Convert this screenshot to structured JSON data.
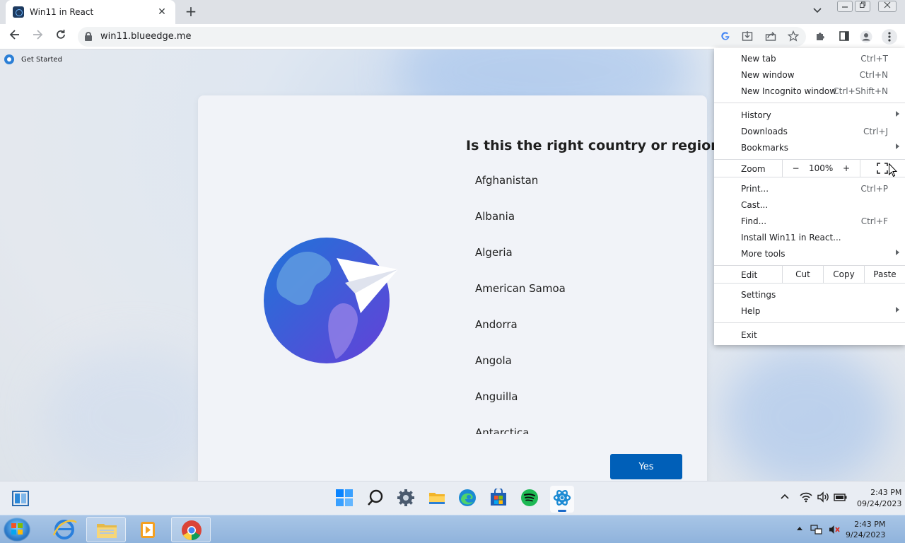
{
  "browser": {
    "tab_title": "Win11 in React",
    "tab_close": "✕",
    "new_tab": "+",
    "url": "win11.blueedge.me"
  },
  "bookmarks": [
    {
      "label": "Get Started"
    }
  ],
  "setup": {
    "question": "Is this the right country or region?",
    "countries": [
      "Afghanistan",
      "Albania",
      "Algeria",
      "American Samoa",
      "Andorra",
      "Angola",
      "Anguilla",
      "Antarctica"
    ],
    "yes_label": "Yes"
  },
  "menu": {
    "group1": [
      {
        "label": "New tab",
        "shortcut": "Ctrl+T"
      },
      {
        "label": "New window",
        "shortcut": "Ctrl+N"
      },
      {
        "label": "New Incognito window",
        "shortcut": "Ctrl+Shift+N"
      }
    ],
    "group2": [
      {
        "label": "History",
        "shortcut": ""
      },
      {
        "label": "Downloads",
        "shortcut": "Ctrl+J"
      },
      {
        "label": "Bookmarks",
        "shortcut": ""
      }
    ],
    "zoom": {
      "label": "Zoom",
      "minus": "−",
      "value": "100%",
      "plus": "+"
    },
    "group3": [
      {
        "label": "Print...",
        "shortcut": "Ctrl+P"
      },
      {
        "label": "Cast...",
        "shortcut": ""
      },
      {
        "label": "Find...",
        "shortcut": "Ctrl+F"
      },
      {
        "label": "Install Win11 in React...",
        "shortcut": ""
      },
      {
        "label": "More tools",
        "shortcut": ""
      }
    ],
    "edit": {
      "label": "Edit",
      "cut": "Cut",
      "copy": "Copy",
      "paste": "Paste"
    },
    "group4": [
      {
        "label": "Settings",
        "shortcut": ""
      },
      {
        "label": "Help",
        "shortcut": ""
      }
    ],
    "exit": "Exit"
  },
  "win11_taskbar": {
    "time": "2:43 PM",
    "date": "09/24/2023"
  },
  "win7_taskbar": {
    "time": "2:43 PM",
    "date": "9/24/2023"
  }
}
